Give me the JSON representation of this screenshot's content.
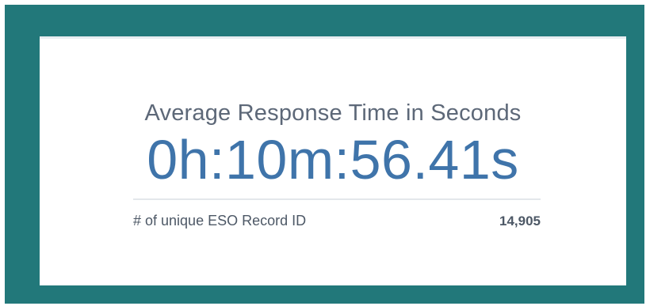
{
  "widget": {
    "title": "Average Response Time in Seconds",
    "value": "0h:10m:56.41s",
    "secondary": {
      "label": "# of unique ESO Record ID",
      "value": "14,905"
    }
  },
  "colors": {
    "frame": "#22787a",
    "card_background": "#ffffff",
    "value_text": "#3f74aa",
    "title_text": "#5d6878"
  }
}
